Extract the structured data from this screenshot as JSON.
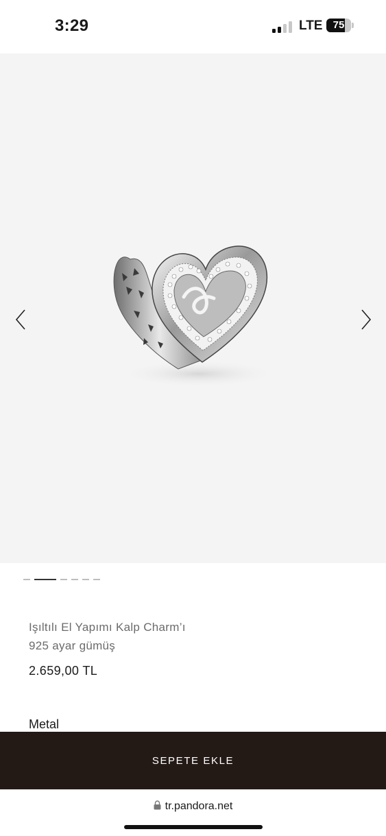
{
  "status_bar": {
    "time": "3:29",
    "network": "LTE",
    "battery_level": "75",
    "battery_fraction": 0.75,
    "signal_bars_active": 2,
    "signal_bars_total": 4
  },
  "gallery": {
    "image_name": "heart-charm-image",
    "prev_icon": "chevron-left-icon",
    "next_icon": "chevron-right-icon",
    "page_count": 6,
    "active_page": 2
  },
  "product": {
    "name": "Işıltılı El Yapımı Kalp Charm’ı",
    "material": "925 ayar gümüş",
    "price": "2.659,00 TL"
  },
  "sections": {
    "metal_label": "Metal"
  },
  "cart": {
    "add_label": "SEPETE EKLE"
  },
  "browser": {
    "url": "tr.pandora.net",
    "lock_icon": "lock-icon"
  },
  "colors": {
    "gallery_bg": "#f4f4f4",
    "cart_button_bg": "#231a16",
    "secondary_text": "#6b6b6b"
  }
}
